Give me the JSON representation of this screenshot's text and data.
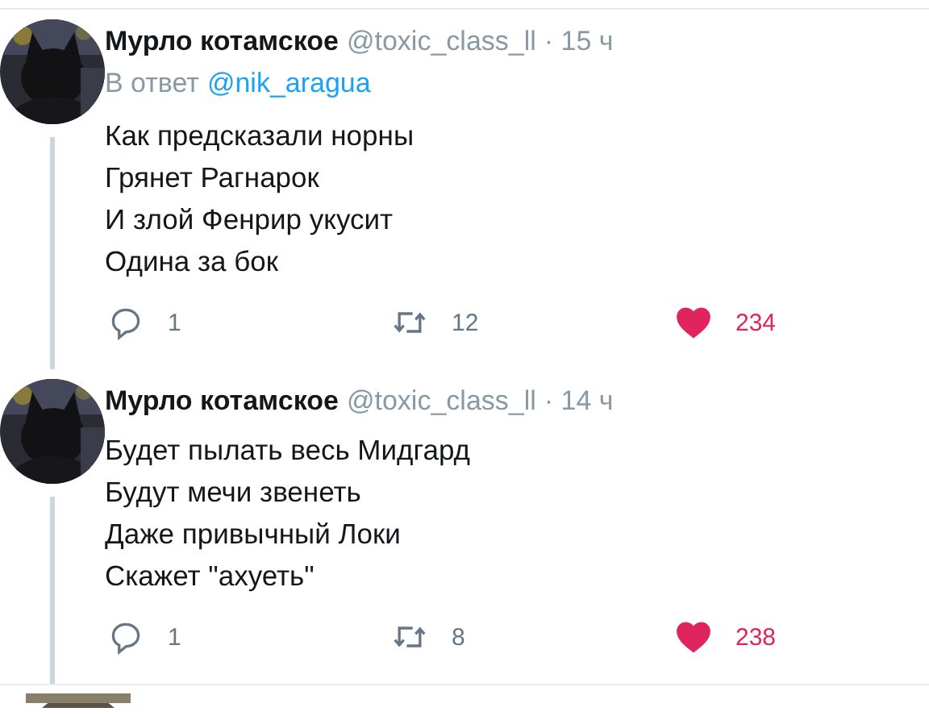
{
  "tweets": [
    {
      "name": "Мурло котамское",
      "handle": "@toxic_class_ll",
      "time": "· 15 ч",
      "reply_label": "В ответ",
      "reply_to": "@nik_aragua",
      "lines": [
        "Как предсказали норны",
        "Грянет Рагнарок",
        "И злой Фенрир укусит",
        "Одина за бок"
      ],
      "replies": "1",
      "retweets": "12",
      "likes": "234",
      "liked": true
    },
    {
      "name": "Мурло котамское",
      "handle": "@toxic_class_ll",
      "time": "· 14 ч",
      "lines": [
        "Будет пылать весь Мидгард",
        "Будут мечи звенеть",
        "Даже привычный Локи",
        "Скажет \"ахуеть\""
      ],
      "replies": "1",
      "retweets": "8",
      "likes": "238",
      "liked": true
    }
  ]
}
